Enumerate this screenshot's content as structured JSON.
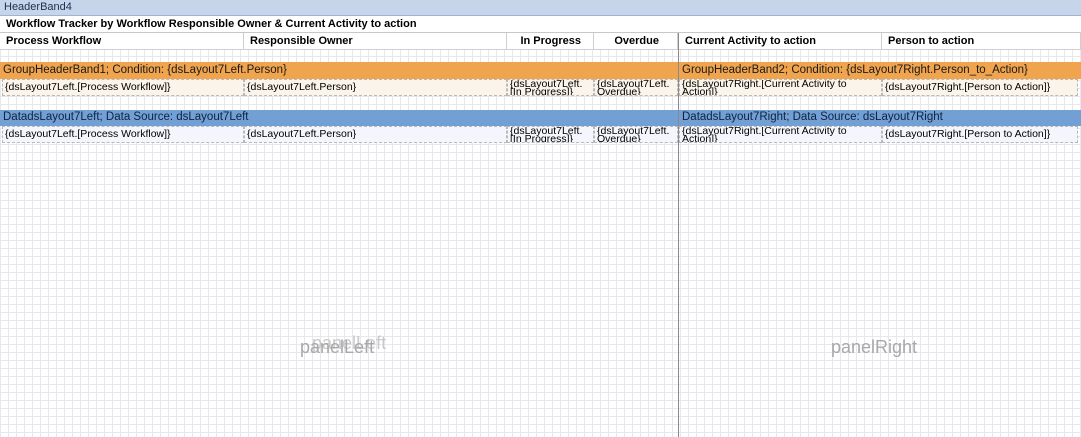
{
  "header_band": "HeaderBand4",
  "report_title": "Workflow Tracker by Workflow Responsible Owner & Current Activity to action",
  "columns": {
    "process_workflow": "Process Workflow",
    "responsible_owner": "Responsible Owner",
    "in_progress": "In Progress",
    "overdue": "Overdue",
    "current_activity": "Current Activity to action",
    "person_to_action": "Person to action"
  },
  "group_header_left": "GroupHeaderBand1; Condition: {dsLayout7Left.Person}",
  "group_header_right": "GroupHeaderBand2; Condition: {dsLayout7Right.Person_to_Action}",
  "group_row_left": {
    "process_workflow": "{dsLayout7Left.[Process Workflow]}",
    "person": "{dsLayout7Left.Person}",
    "in_progress_1": "{dsLayout7Left.",
    "in_progress_2": "[In Progress]}",
    "overdue_1": "{dsLayout7Left.",
    "overdue_2": "Overdue}"
  },
  "group_row_right": {
    "current_activity_1": "{dsLayout7Right.[Current Activity to",
    "current_activity_2": "Action]}",
    "person_to_action": "{dsLayout7Right.[Person to Action]}"
  },
  "data_band_left": "DatadsLayout7Left; Data Source: dsLayout7Left",
  "data_band_right": "DatadsLayout7Right; Data Source: dsLayout7Right",
  "data_row_left": {
    "process_workflow": "{dsLayout7Left.[Process Workflow]}",
    "person": "{dsLayout7Left.Person}",
    "in_progress_1": "{dsLayout7Left.",
    "in_progress_2": "[In Progress]}",
    "overdue_1": "{dsLayout7Left.",
    "overdue_2": "Overdue}"
  },
  "data_row_right": {
    "current_activity_1": "{dsLayout7Right.[Current Activity to",
    "current_activity_2": "Action]}",
    "person_to_action": "{dsLayout7Right.[Person to Action]}"
  },
  "panel_left_label": "panelLeft",
  "panel_right_label": "panelRight"
}
